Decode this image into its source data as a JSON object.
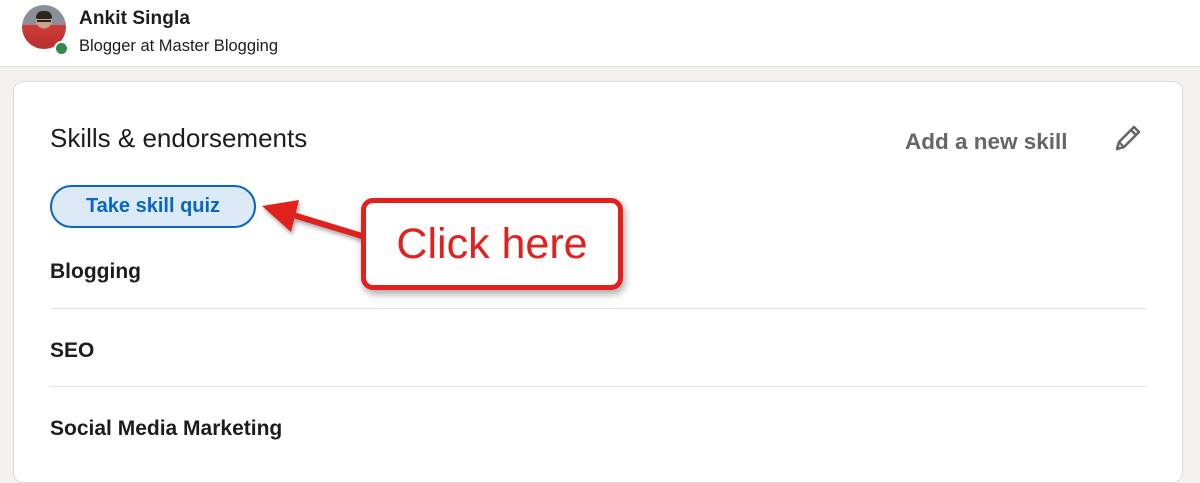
{
  "profile": {
    "name": "Ankit Singla",
    "headline": "Blogger at Master Blogging",
    "avatar_icon": "user-avatar",
    "presence_status": "online",
    "presence_color": "#2f8a4f"
  },
  "skills_card": {
    "title": "Skills & endorsements",
    "add_skill_label": "Add a new skill",
    "edit_icon": "pencil-icon",
    "quiz_button_label": "Take skill quiz",
    "skills": [
      {
        "label": "Blogging"
      },
      {
        "label": "SEO"
      },
      {
        "label": "Social Media Marketing"
      }
    ]
  },
  "annotation": {
    "callout_text": "Click here",
    "color": "#e0211d"
  },
  "colors": {
    "accent": "#0a66c2",
    "page_background": "#f3f2ef"
  }
}
